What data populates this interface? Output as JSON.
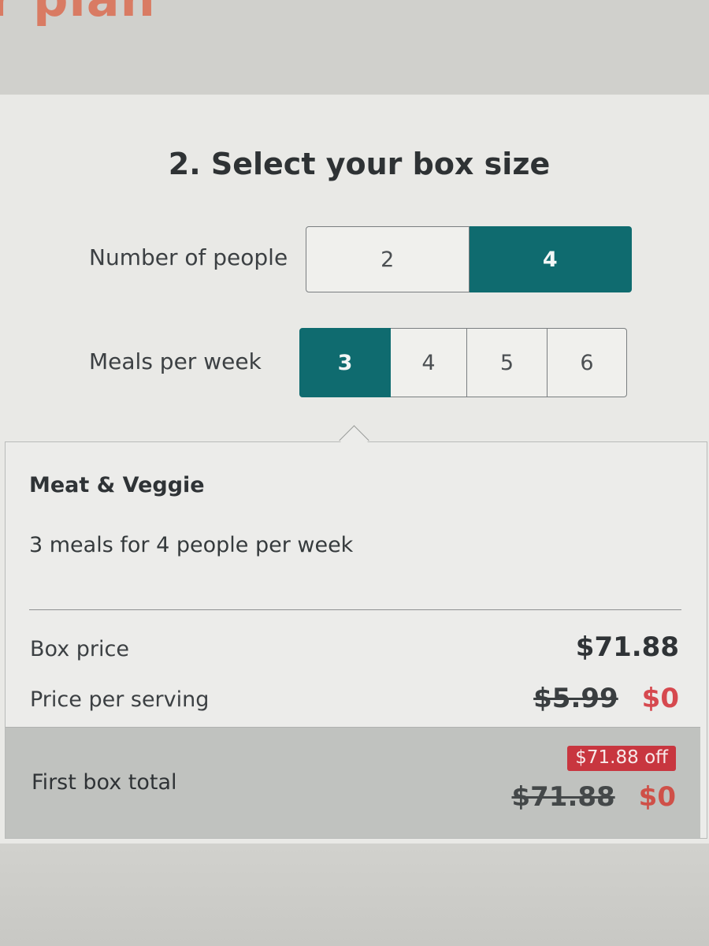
{
  "page_heading_partial": "r plan",
  "section": {
    "title": "2. Select your box size"
  },
  "people": {
    "label": "Number of people",
    "options": [
      "2",
      "4"
    ],
    "selected": "4"
  },
  "meals": {
    "label": "Meals per week",
    "options": [
      "3",
      "4",
      "5",
      "6"
    ],
    "selected": "3"
  },
  "summary": {
    "plan_name": "Meat & Veggie",
    "description": "3 meals for 4 people per week",
    "box_price_label": "Box price",
    "box_price": "$71.88",
    "price_per_serving_label": "Price per serving",
    "price_per_serving_original": "$5.99",
    "price_per_serving_discounted": "$0",
    "first_box_total_label": "First box total",
    "discount_badge": "$71.88 off",
    "first_box_total_original": "$71.88",
    "first_box_total_discounted": "$0"
  },
  "colors": {
    "selected": "#0f6b6f",
    "discount": "#d6494f",
    "heading_accent": "#d97b63"
  }
}
